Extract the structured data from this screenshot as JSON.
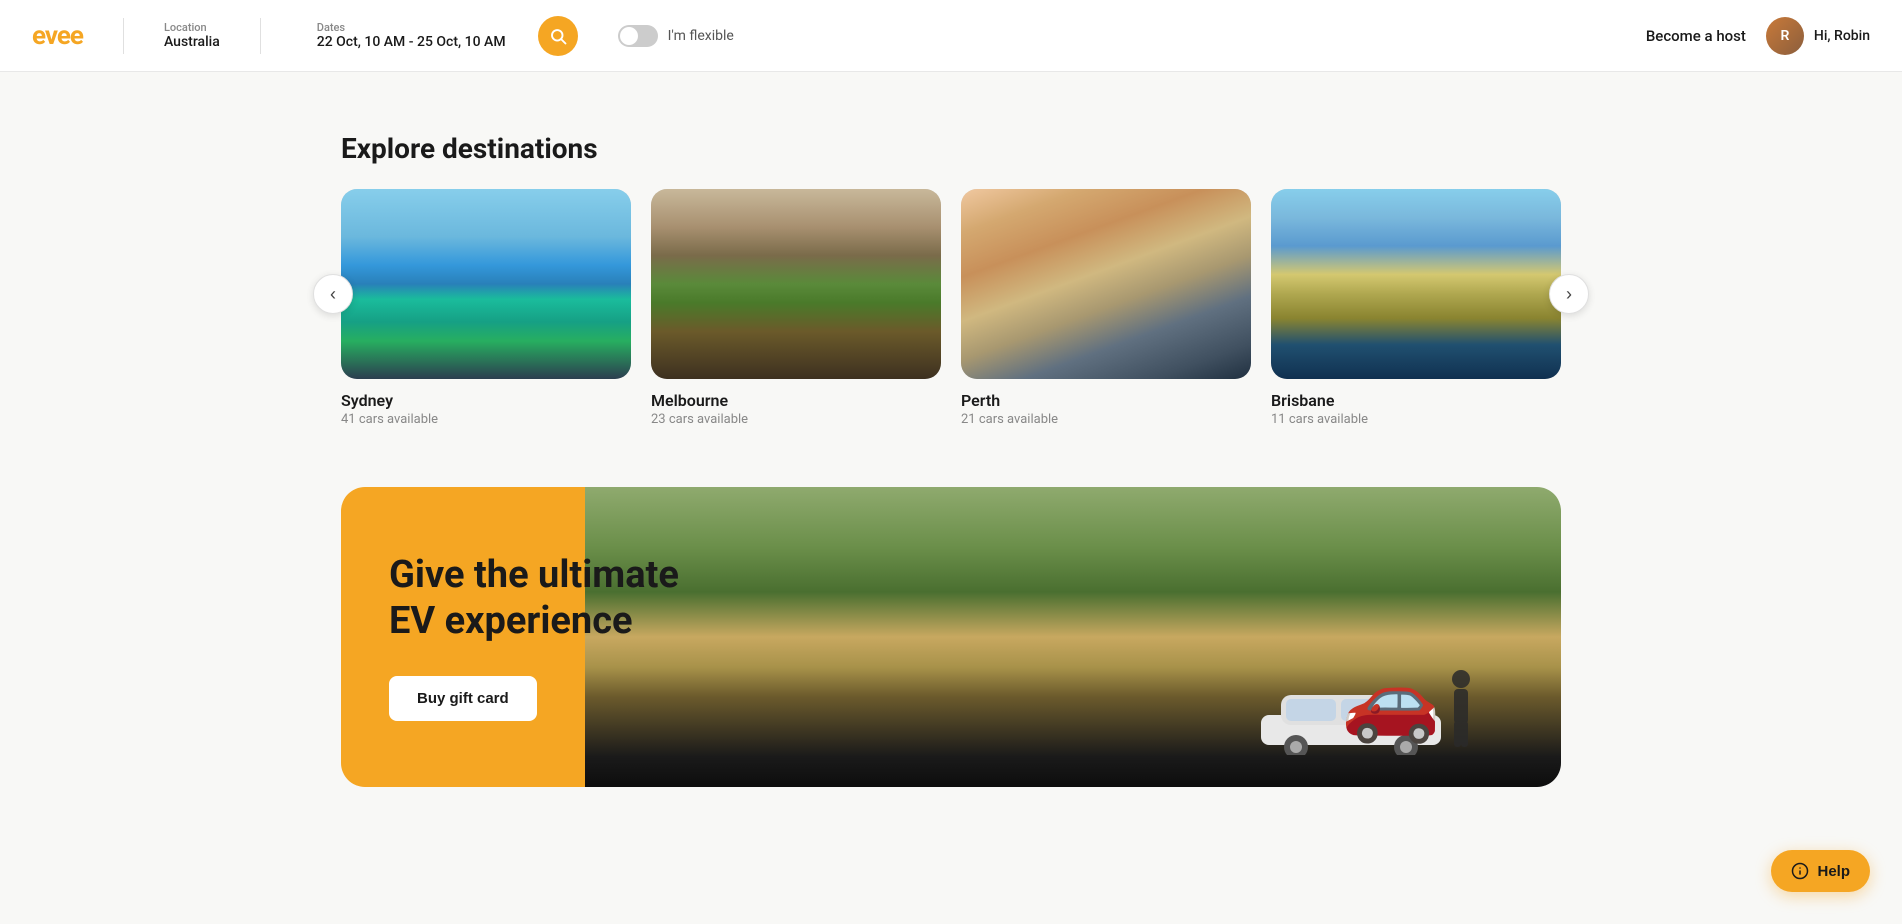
{
  "logo": {
    "text": "evee"
  },
  "navbar": {
    "location_label": "Location",
    "location_value": "Australia",
    "dates_label": "Dates",
    "dates_value": "22 Oct, 10 AM - 25 Oct, 10 AM",
    "flexible_label": "I'm flexible",
    "become_host": "Become a host",
    "user_greeting": "Hi, Robin",
    "user_initial": "R"
  },
  "explore": {
    "section_title": "Explore destinations",
    "destinations": [
      {
        "id": "sydney",
        "name": "Sydney",
        "cars": "41 cars available"
      },
      {
        "id": "melbourne",
        "name": "Melbourne",
        "cars": "23 cars available"
      },
      {
        "id": "perth",
        "name": "Perth",
        "cars": "21 cars available"
      },
      {
        "id": "brisbane",
        "name": "Brisbane",
        "cars": "11 cars available"
      }
    ],
    "prev_btn": "‹",
    "next_btn": "›"
  },
  "gift": {
    "title_line1": "Give the ultimate",
    "title_line2": "EV experience",
    "button_label": "Buy gift card"
  },
  "help": {
    "label": "Help"
  },
  "colors": {
    "accent": "#f5a623"
  }
}
